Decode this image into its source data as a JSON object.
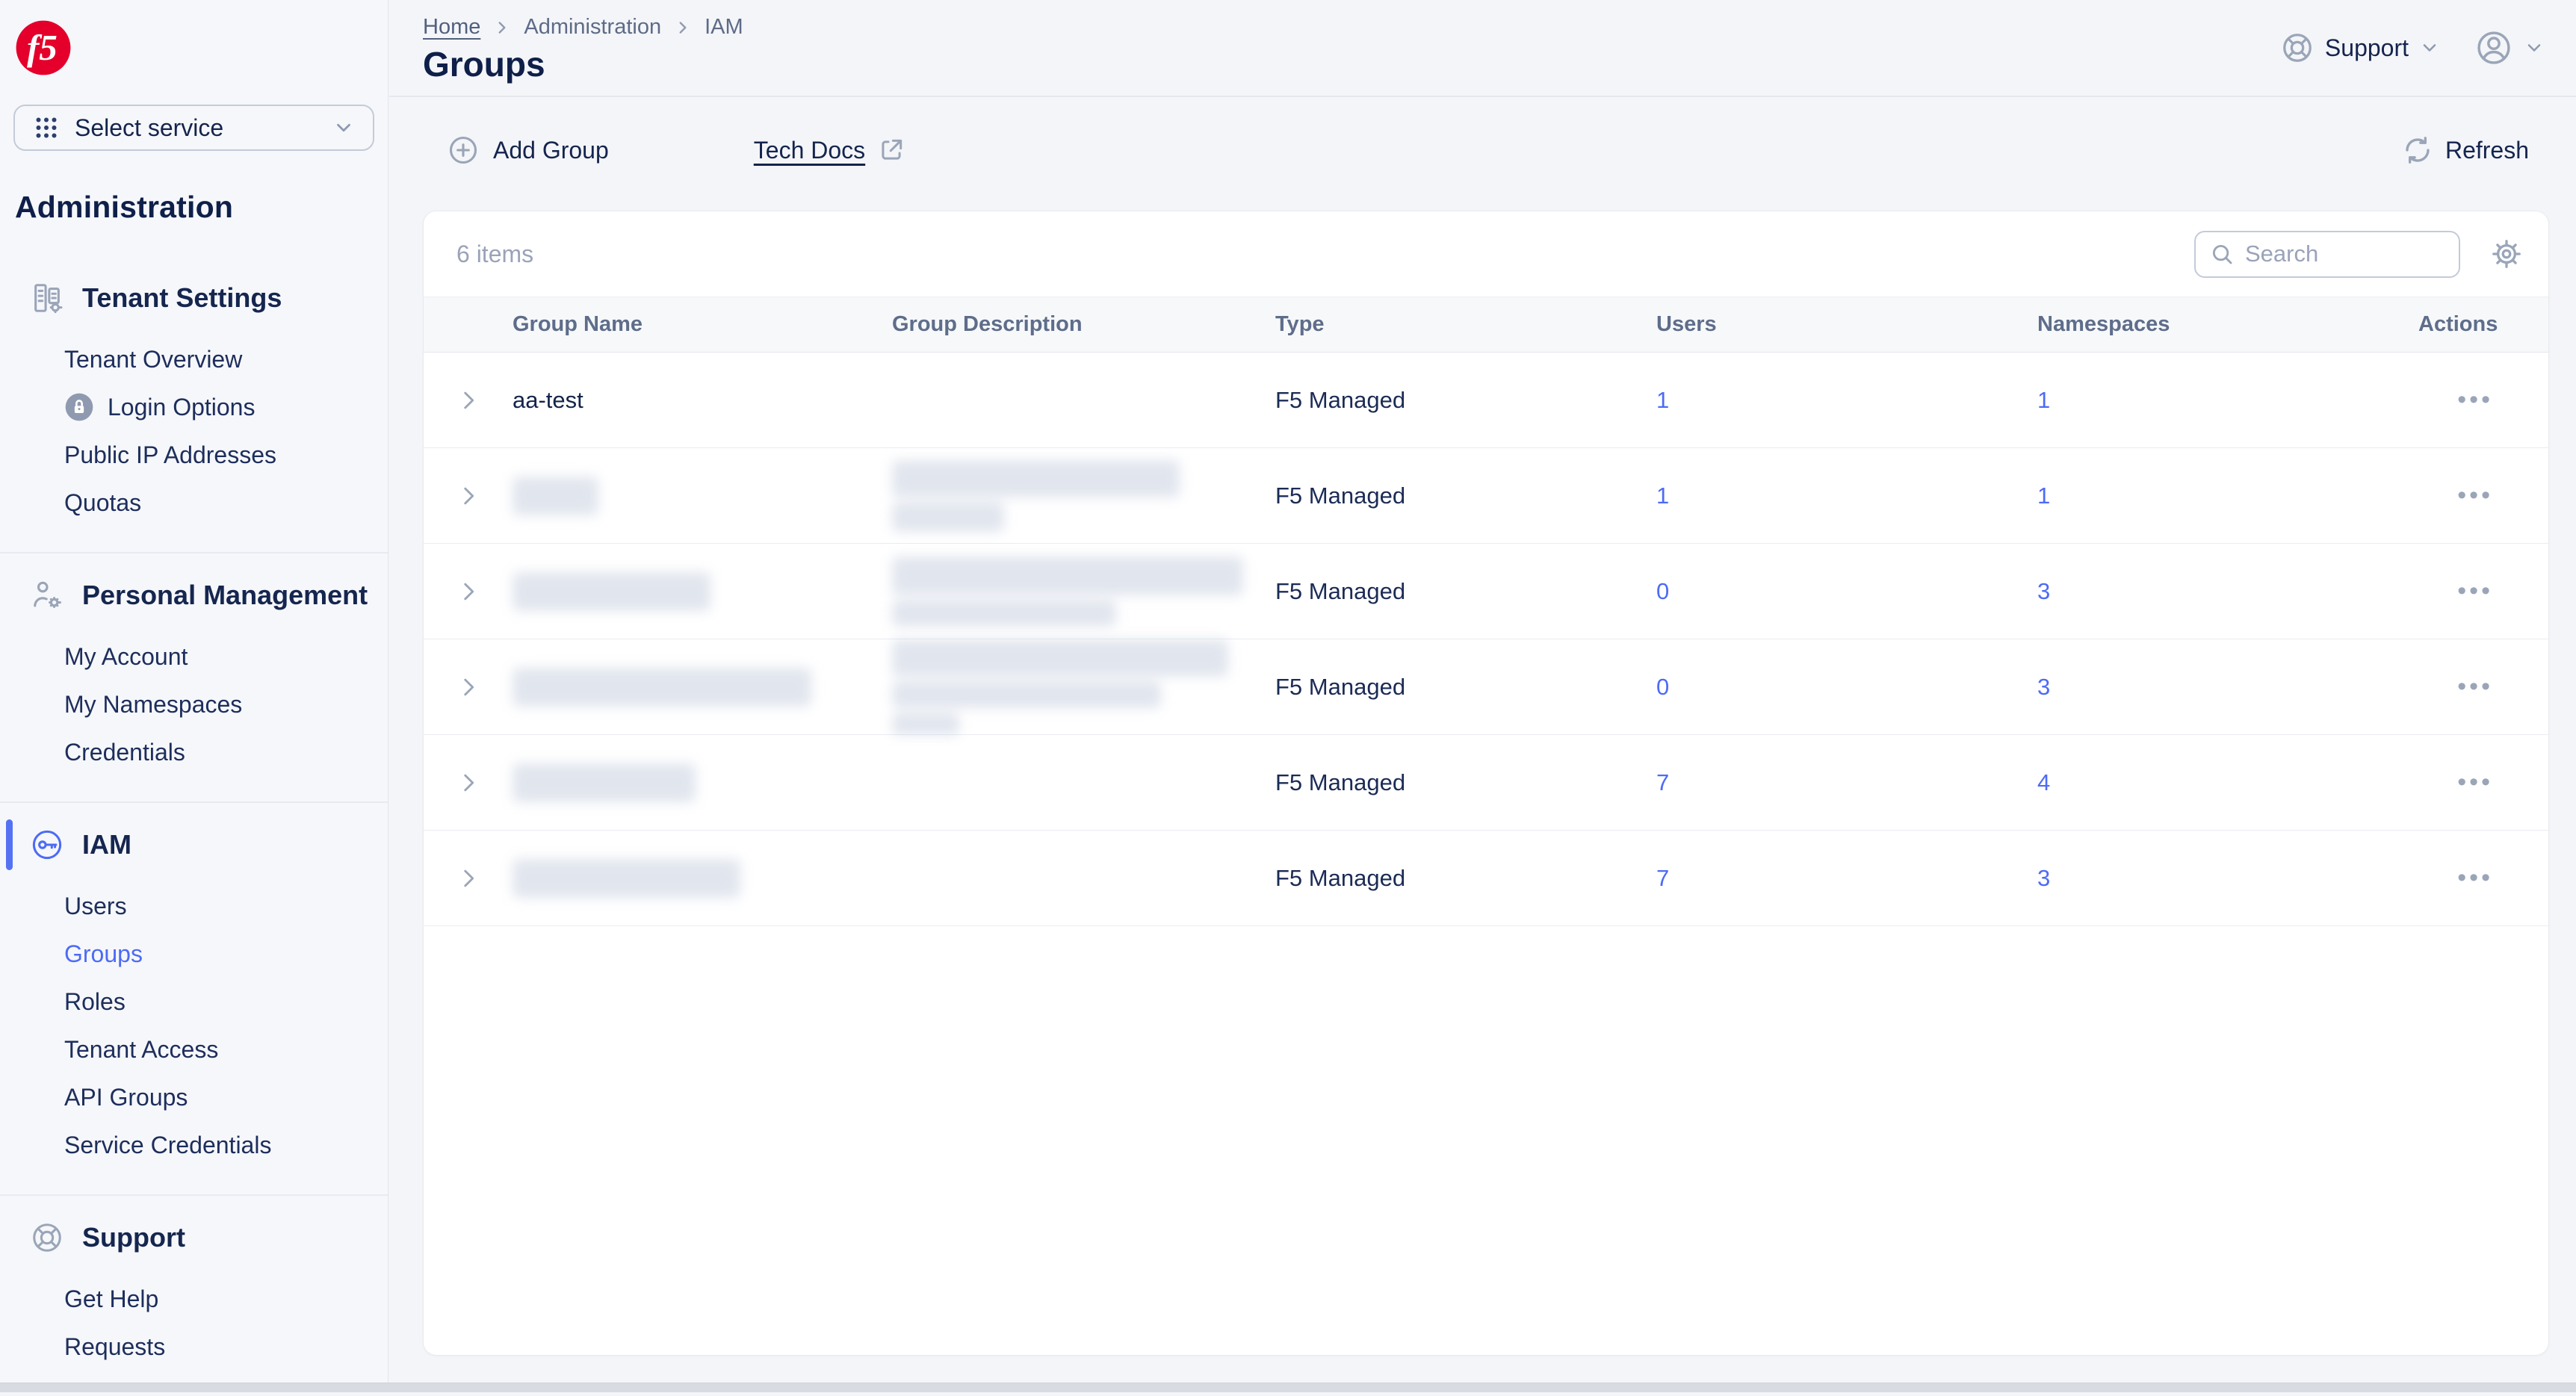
{
  "brand": {
    "logo_text": "f5",
    "brand_red": "#e4002b"
  },
  "sidebar": {
    "select_service_label": "Select service",
    "product_title": "Administration",
    "sections": [
      {
        "title": "Tenant Settings",
        "icon": "building-gear",
        "active": false,
        "items": [
          {
            "label": "Tenant Overview"
          },
          {
            "label": "Login Options",
            "lock": true
          },
          {
            "label": "Public IP Addresses"
          },
          {
            "label": "Quotas"
          }
        ]
      },
      {
        "title": "Personal Management",
        "icon": "person-gear",
        "active": false,
        "items": [
          {
            "label": "My Account"
          },
          {
            "label": "My Namespaces"
          },
          {
            "label": "Credentials"
          }
        ]
      },
      {
        "title": "IAM",
        "icon": "key",
        "active": true,
        "items": [
          {
            "label": "Users"
          },
          {
            "label": "Groups",
            "active": true
          },
          {
            "label": "Roles"
          },
          {
            "label": "Tenant Access"
          },
          {
            "label": "API Groups"
          },
          {
            "label": "Service Credentials"
          }
        ]
      },
      {
        "title": "Support",
        "icon": "lifebuoy",
        "active": false,
        "items": [
          {
            "label": "Get Help"
          },
          {
            "label": "Requests"
          }
        ]
      }
    ]
  },
  "header": {
    "breadcrumb": [
      "Home",
      "Administration",
      "IAM"
    ],
    "title": "Groups",
    "support_label": "Support"
  },
  "toolbar": {
    "add_group_label": "Add Group",
    "tech_docs_label": "Tech Docs",
    "refresh_label": "Refresh"
  },
  "table": {
    "items_count": "6 items",
    "search_placeholder": "Search",
    "columns": [
      "Group Name",
      "Group Description",
      "Type",
      "Users",
      "Namespaces",
      "Actions"
    ],
    "rows": [
      {
        "name": "aa-test",
        "type": "F5 Managed",
        "users": "1",
        "namespaces": "1",
        "redact": null
      },
      {
        "name": "",
        "type": "F5 Managed",
        "users": "1",
        "namespaces": "1",
        "redact": {
          "name_w": 115,
          "desc": [
            [
              385,
              50
            ],
            [
              150,
              40
            ]
          ]
        }
      },
      {
        "name": "",
        "type": "F5 Managed",
        "users": "0",
        "namespaces": "3",
        "redact": {
          "name_w": 265,
          "desc": [
            [
              470,
              52
            ],
            [
              300,
              36
            ]
          ]
        }
      },
      {
        "name": "",
        "type": "F5 Managed",
        "users": "0",
        "namespaces": "3",
        "redact": {
          "name_w": 400,
          "desc": [
            [
              450,
              50
            ],
            [
              360,
              36
            ],
            [
              90,
              30
            ]
          ]
        }
      },
      {
        "name": "",
        "type": "F5 Managed",
        "users": "7",
        "namespaces": "4",
        "redact": {
          "name_w": 245,
          "desc": null
        }
      },
      {
        "name": "",
        "type": "F5 Managed",
        "users": "7",
        "namespaces": "3",
        "redact": {
          "name_w": 305,
          "desc": null
        }
      }
    ],
    "actions_ellipsis": "•••"
  },
  "colors": {
    "accent_blue": "#4d6bf5",
    "navy": "#14244e",
    "brand_red": "#e4002b"
  }
}
